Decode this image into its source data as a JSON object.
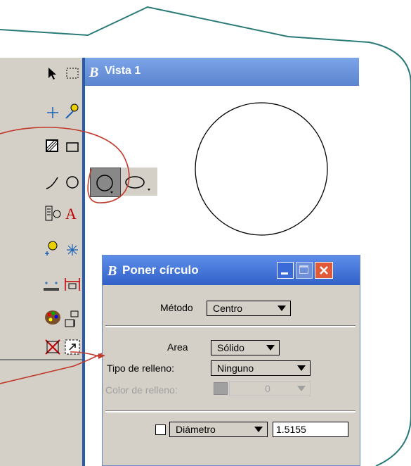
{
  "view": {
    "title": "Vista 1"
  },
  "palette": {
    "tools": [
      "select-arrow",
      "select-rect",
      "crosshair",
      "lightbulb-line",
      "hatch",
      "rectangle",
      "arc",
      "circle",
      "text-place",
      "text-A",
      "lightbulb-star",
      "star-point",
      "dimension-dots",
      "dimension-span",
      "palette",
      "fence",
      "delete-x",
      "fit-view"
    ]
  },
  "dialog": {
    "title": "Poner círculo",
    "method_label": "Método",
    "method_value": "Centro",
    "area_label": "Area",
    "area_value": "Sólido",
    "fill_type_label": "Tipo de relleno:",
    "fill_type_value": "Ninguno",
    "fill_color_label": "Color de relleno:",
    "fill_color_value": "0",
    "dimension_option": "Diámetro",
    "dimension_value": "1.5155"
  },
  "colors": {
    "title_blue": "#3160c8",
    "annotation_red": "#c0392b",
    "frame_teal": "#2a7a78"
  }
}
